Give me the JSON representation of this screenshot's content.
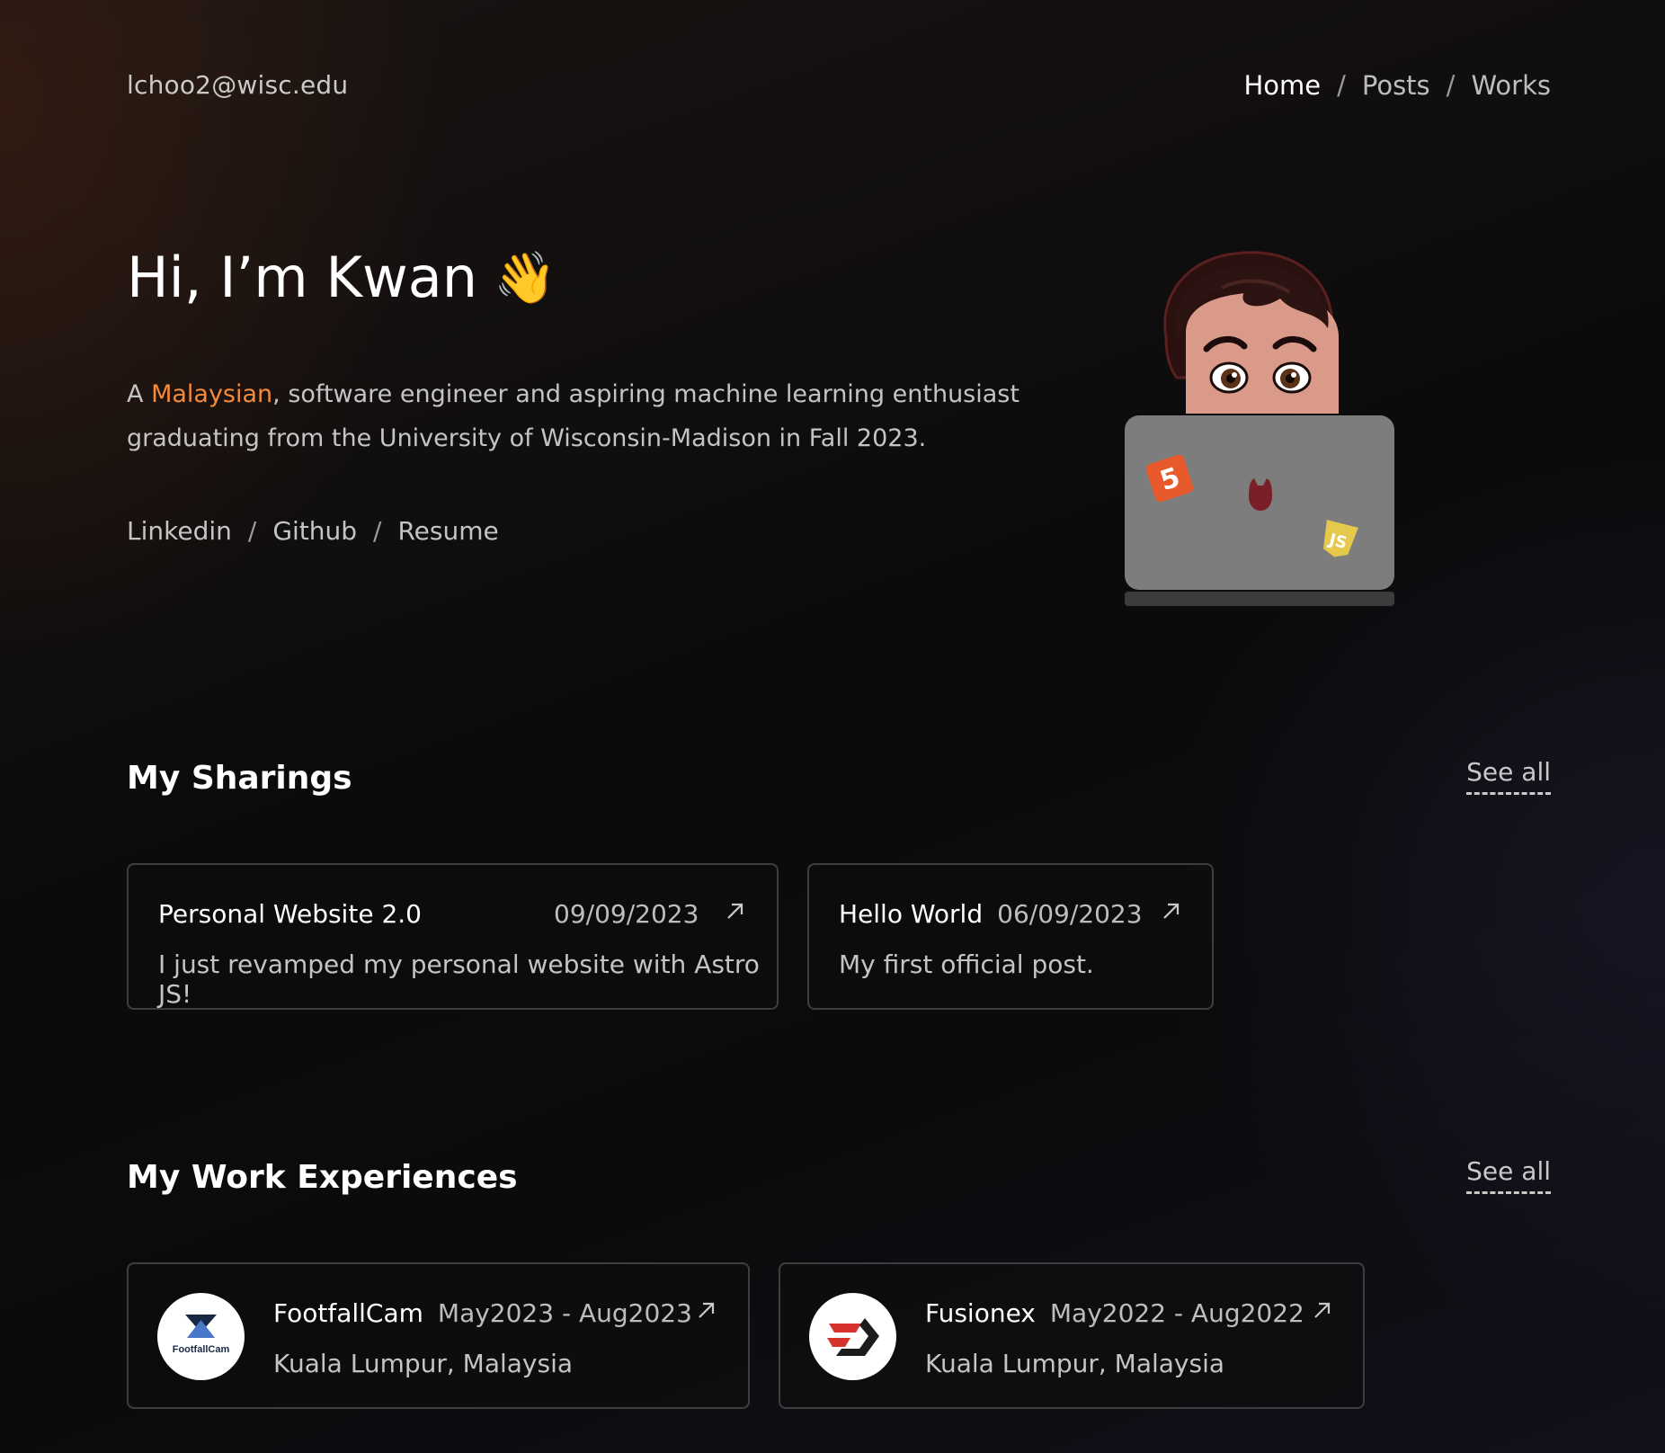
{
  "header": {
    "email": "lchoo2@wisc.edu",
    "nav": [
      {
        "label": "Home",
        "active": true
      },
      {
        "label": "Posts",
        "active": false
      },
      {
        "label": "Works",
        "active": false
      }
    ],
    "separator": "/"
  },
  "hero": {
    "title": "Hi, I’m Kwan",
    "wave_emoji": "👋",
    "bio_prefix": "A ",
    "bio_accent": "Malaysian",
    "bio_rest": ", software engineer and aspiring machine learning enthusiast graduating from the University of Wisconsin-Madison in Fall 2023.",
    "links": [
      "Linkedin",
      "Github",
      "Resume"
    ],
    "accent_color": "#f58a3a",
    "avatar_icon": "memoji-laptop-icon",
    "laptop_stickers": [
      "html5-sticker-icon",
      "js-sticker-icon",
      "cat-logo-icon"
    ]
  },
  "sharings": {
    "title": "My Sharings",
    "see_all": "See all",
    "posts": [
      {
        "title": "Personal Website 2.0",
        "date": "09/09/2023",
        "description": "I just revamped my personal website with Astro JS!"
      },
      {
        "title": "Hello World",
        "date": "06/09/2023",
        "description": "My first official post."
      }
    ]
  },
  "work": {
    "title": "My Work Experiences",
    "see_all": "See all",
    "jobs": [
      {
        "company": "FootfallCam",
        "period": "May2023 - Aug2023",
        "location": "Kuala Lumpur, Malaysia",
        "logo_text": "FootfallCam",
        "logo_icon": "footfallcam-logo-icon"
      },
      {
        "company": "Fusionex",
        "period": "May2022 - Aug2022",
        "location": "Kuala Lumpur, Malaysia",
        "logo_icon": "fusionex-logo-icon"
      }
    ]
  }
}
